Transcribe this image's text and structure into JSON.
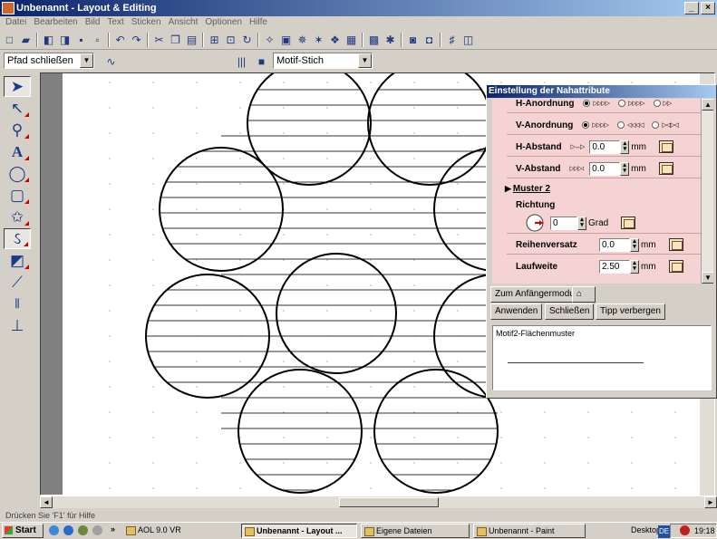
{
  "window": {
    "title": "Unbenannt - Layout & Editing",
    "controls": [
      "_",
      "×"
    ]
  },
  "menu": [
    "Datei",
    "Bearbeiten",
    "Bild",
    "Text",
    "Sticken",
    "Ansicht",
    "Optionen",
    "Hilfe"
  ],
  "toolbar2": {
    "path_select": "Pfad schließen",
    "stitch_select": "Motif-Stich"
  },
  "panel": {
    "title": "Einstellung der Nahattribute",
    "h_anordnung": "H-Anordnung",
    "v_anordnung": "V-Anordnung",
    "h_abstand": {
      "label": "H-Abstand",
      "value": "0.0",
      "unit": "mm"
    },
    "v_abstand": {
      "label": "V-Abstand",
      "value": "0.0",
      "unit": "mm"
    },
    "muster2": "Muster 2",
    "richtung": {
      "label": "Richtung",
      "value": "0",
      "unit": "Grad"
    },
    "reihenversatz": {
      "label": "Reihenversatz",
      "value": "0.0",
      "unit": "mm"
    },
    "laufweite": {
      "label": "Laufweite",
      "value": "2.50",
      "unit": "mm"
    },
    "buttons": {
      "beginner": "Zum Anfängermodus",
      "apply": "Anwenden",
      "close": "Schließen",
      "hide_tip": "Tipp verbergen"
    },
    "tip_text": "Motif2-Flächenmuster"
  },
  "status": "Drücken Sie 'F1' für Hilfe",
  "taskbar": {
    "start": "Start",
    "items": [
      "AOL 9.0 VR",
      "Unbenannt - Layout ...",
      "Eigene Dateien",
      "Unbenannt - Paint"
    ],
    "desktop": "Desktop",
    "lang": "DE",
    "clock": "19:18"
  }
}
